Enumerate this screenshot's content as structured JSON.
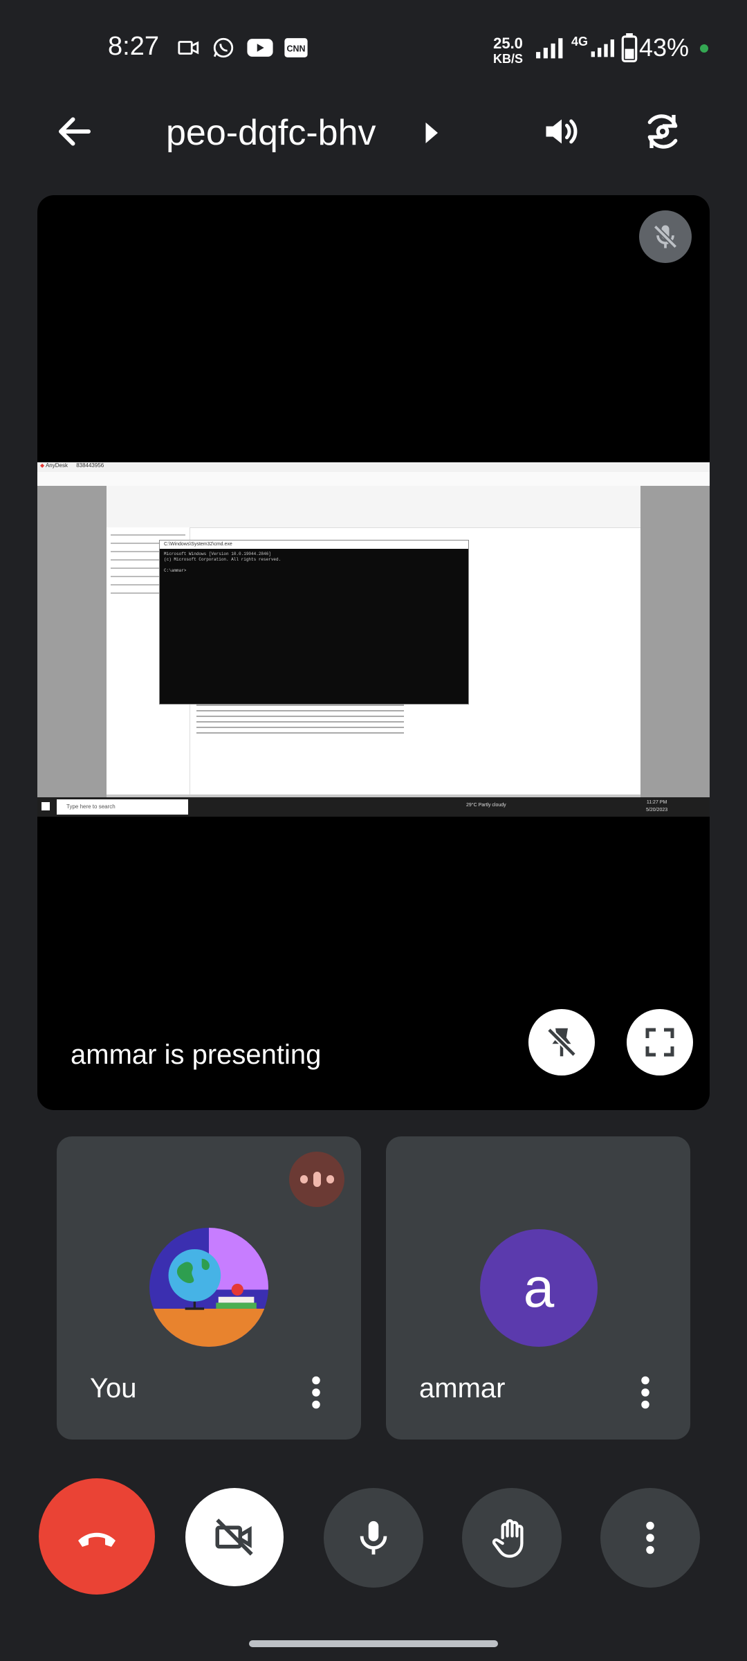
{
  "status_bar": {
    "time": "8:27",
    "net_speed_value": "25.0",
    "net_speed_unit": "KB/S",
    "network": "4G",
    "battery": "43%",
    "icons": [
      "video-camera-icon",
      "whatsapp-icon",
      "youtube-icon",
      "cnn-icon",
      "signal-icon",
      "battery-icon"
    ]
  },
  "header": {
    "meeting_code": "peo-dqfc-bhv",
    "icons": [
      "back-arrow-icon",
      "chevron-right-icon",
      "speaker-icon",
      "switch-camera-icon"
    ]
  },
  "presentation": {
    "label": "ammar is presenting",
    "icons": [
      "mic-off-icon",
      "unpin-icon",
      "fullscreen-icon"
    ],
    "shared_screen": {
      "anydesk_title": "AnyDesk",
      "anydesk_id": "838443956",
      "cmd_title": "C:\\Windows\\System32\\cmd.exe",
      "cmd_line1": "Microsoft Windows [Version 10.0.19044.2846]",
      "cmd_line2": "(c) Microsoft Corporation. All rights reserved.",
      "cmd_prompt": "C:\\ammar>",
      "taskbar_search": "Type here to search",
      "taskbar_weather": "29°C Partly cloudy",
      "taskbar_time": "11:27 PM",
      "taskbar_date": "5/20/2023"
    }
  },
  "participants": [
    {
      "name": "You",
      "avatar": "globe-books-illustration",
      "speaking": true
    },
    {
      "name": "ammar",
      "avatar_letter": "a",
      "avatar_color": "#5b3aad"
    }
  ],
  "controls": {
    "end_call_color": "#ea4335",
    "icons": [
      "end-call-icon",
      "camera-off-icon",
      "mic-icon",
      "raise-hand-icon",
      "more-vert-icon"
    ]
  }
}
